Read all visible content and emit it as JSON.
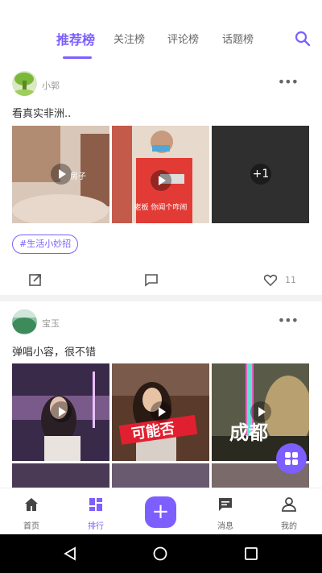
{
  "header": {
    "tabs": [
      {
        "label": "推荐榜"
      },
      {
        "label": "关注榜"
      },
      {
        "label": "评论榜"
      },
      {
        "label": "话题榜"
      }
    ],
    "search_icon": "search-icon"
  },
  "posts": [
    {
      "username": "小郭",
      "text": "看真实非洲..",
      "images": [
        {
          "overlay": "房子"
        },
        {
          "overlay": "老板 你闻个咋闹"
        },
        {
          "overlay": "+1"
        }
      ],
      "tag": "#生活小妙招",
      "likes": "11"
    },
    {
      "username": "宝玉",
      "text": "弹唱小容，很不错",
      "images": [
        {
          "overlay": ""
        },
        {
          "overlay": "可能否"
        },
        {
          "overlay": "成都"
        }
      ]
    }
  ],
  "bottom_nav": {
    "items": [
      {
        "label": "首页",
        "icon": "home-icon"
      },
      {
        "label": "排行",
        "icon": "grid-icon"
      },
      {
        "label": "消息",
        "icon": "message-icon"
      },
      {
        "label": "我的",
        "icon": "person-icon"
      }
    ]
  },
  "colors": {
    "accent": "#7d5fff"
  }
}
